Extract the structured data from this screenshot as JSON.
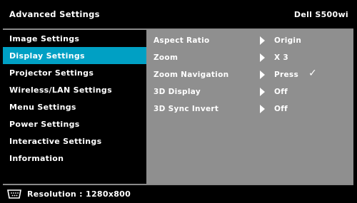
{
  "header": {
    "title": "Advanced Settings",
    "model": "Dell S500wi"
  },
  "sidebar": {
    "items": [
      {
        "label": "Image Settings",
        "active": false
      },
      {
        "label": "Display Settings",
        "active": true
      },
      {
        "label": "Projector Settings",
        "active": false
      },
      {
        "label": "Wireless/LAN Settings",
        "active": false
      },
      {
        "label": "Menu Settings",
        "active": false
      },
      {
        "label": "Power Settings",
        "active": false
      },
      {
        "label": "Interactive Settings",
        "active": false
      },
      {
        "label": "Information",
        "active": false
      }
    ]
  },
  "settings": {
    "rows": [
      {
        "label": "Aspect Ratio",
        "value": "Origin"
      },
      {
        "label": "Zoom",
        "value": "X 3"
      },
      {
        "label": "Zoom Navigation",
        "value": "Press",
        "check": "✓"
      },
      {
        "label": "3D Display",
        "value": "Off"
      },
      {
        "label": "3D Sync Invert",
        "value": "Off"
      }
    ]
  },
  "status": {
    "icon": "video-input-icon",
    "text": "Resolution : 1280x800"
  },
  "colors": {
    "active": "#00a0c4",
    "panel": "#8f8f8f",
    "background": "#000000"
  }
}
